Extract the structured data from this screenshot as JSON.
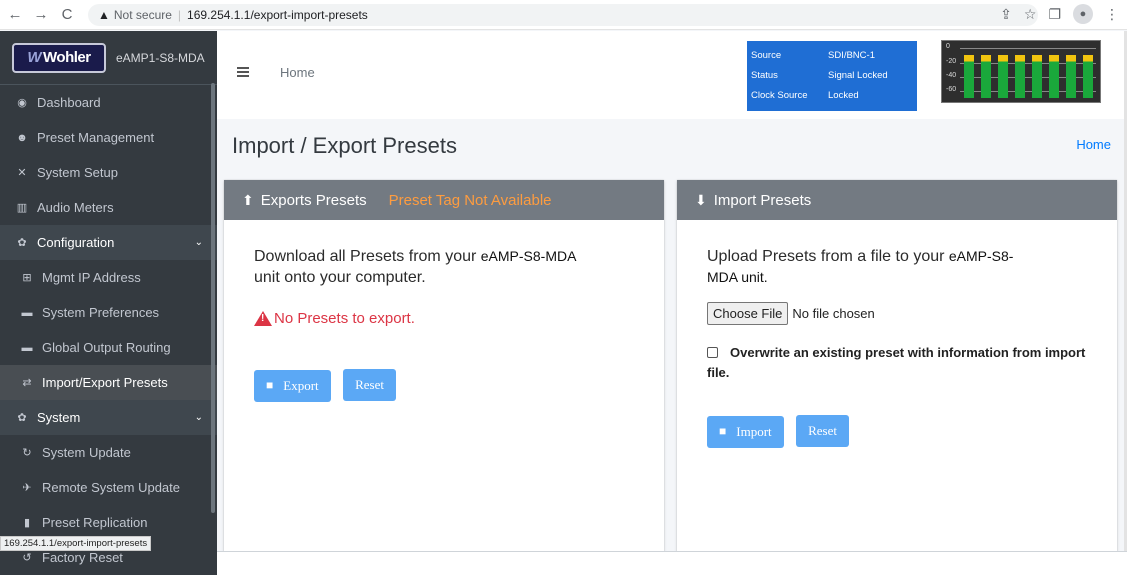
{
  "browser": {
    "back_icon": "←",
    "forward_icon": "→",
    "reload_icon": "C",
    "warning_icon": "▲",
    "not_secure": "Not secure",
    "separator": "|",
    "url": "169.254.1.1/export-import-presets",
    "share_icon": "⇪",
    "star_icon": "☆",
    "panel_icon": "❐",
    "profile_icon": "●",
    "menu_icon": "⋮"
  },
  "sidebar": {
    "logo_text": "Wohler",
    "logo_mark": "W",
    "device_name": "eAMP1-S8-MDA",
    "items": [
      {
        "icon": "◉",
        "label": "Dashboard"
      },
      {
        "icon": "☻",
        "label": "Preset Management"
      },
      {
        "icon": "✕",
        "label": "System Setup"
      },
      {
        "icon": "▥",
        "label": "Audio Meters"
      },
      {
        "icon": "✿",
        "label": "Configuration",
        "chevron": "⌄"
      },
      {
        "icon": "⊞",
        "label": "Mgmt IP Address"
      },
      {
        "icon": "▬",
        "label": "System Preferences"
      },
      {
        "icon": "▬",
        "label": "Global Output Routing"
      },
      {
        "icon": "⇄",
        "label": "Import/Export Presets"
      },
      {
        "icon": "✿",
        "label": "System",
        "chevron": "⌄"
      },
      {
        "icon": "↻",
        "label": "System Update"
      },
      {
        "icon": "✈",
        "label": "Remote System Update"
      },
      {
        "icon": "▮",
        "label": "Preset Replication"
      },
      {
        "icon": "↺",
        "label": "Factory Reset"
      }
    ],
    "status_url": "169.254.1.1/export-import-presets"
  },
  "topbar": {
    "home_label": "Home",
    "info": [
      {
        "key": "Source",
        "value": "SDI/BNC-1"
      },
      {
        "key": "Status",
        "value": "Signal Locked"
      },
      {
        "key": "Clock Source",
        "value": "Locked"
      }
    ],
    "meter": {
      "scale": [
        "0",
        "-20",
        "-40",
        "-60"
      ],
      "levels": [
        0.82,
        0.82,
        0.82,
        0.82,
        0.82,
        0.82,
        0.82,
        0.82
      ],
      "green": "#1aa83b",
      "yellow": "#f1c40f"
    }
  },
  "main": {
    "title": "Import / Export Presets",
    "breadcrumb_home": "Home",
    "export_card": {
      "title": "Exports Presets",
      "tag": "Preset Tag Not Available",
      "desc_prefix": "Download all Presets from your",
      "unit": "eAMP-S8-MDA",
      "desc_suffix": "unit onto your computer.",
      "warning": "No Presets to export.",
      "export_button": "Export",
      "reset_button": "Reset"
    },
    "import_card": {
      "title": "Import Presets",
      "desc_prefix": "Upload Presets from a file to your",
      "unit": "eAMP-S8-",
      "unit_rest": "MDA unit.",
      "choose_file": "Choose File",
      "no_file": "No file chosen",
      "overwrite_label": "Overwrite an existing preset with information from import file.",
      "import_button": "Import",
      "reset_button": "Reset"
    }
  },
  "colors": {
    "sidebar_bg": "#343a40",
    "card_header": "#737a82",
    "button": "#5ba8f5",
    "danger": "#dc3545",
    "warning": "#fd9c40",
    "info_box": "#1f6ed4"
  }
}
